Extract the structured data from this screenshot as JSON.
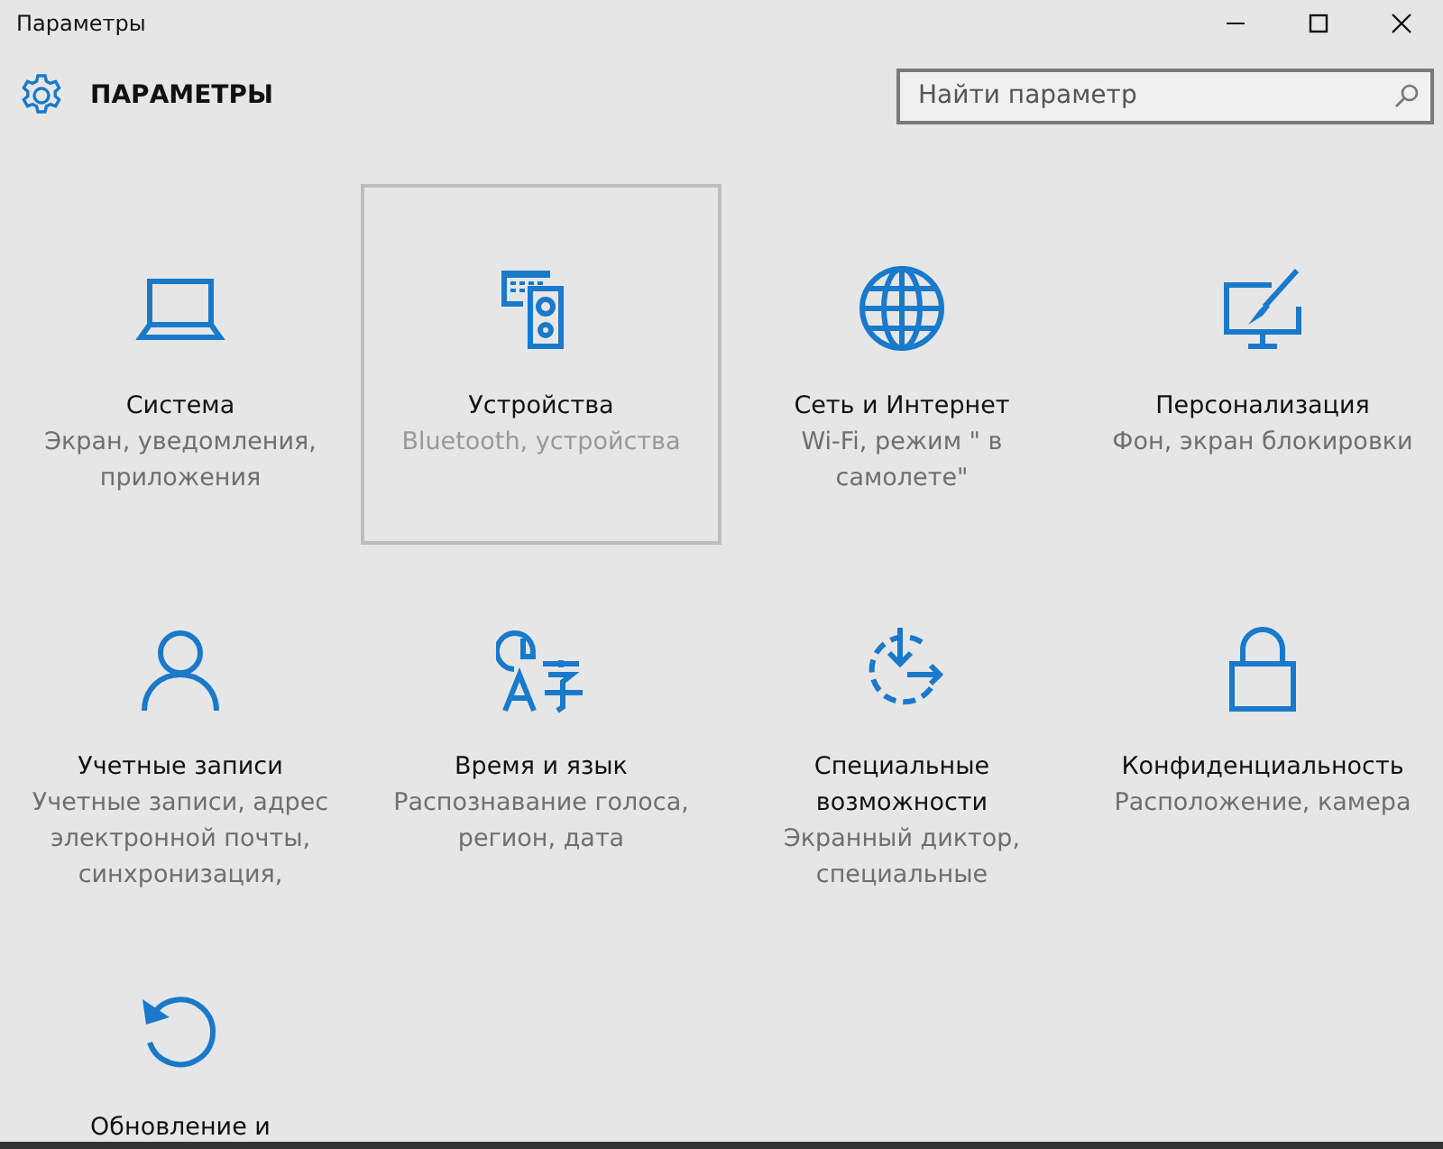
{
  "window": {
    "title": "Параметры"
  },
  "header": {
    "title": "ПАРАМЕТРЫ",
    "search": {
      "placeholder": "Найти параметр"
    }
  },
  "tiles": [
    {
      "title": "Система",
      "description": "Экран, уведомления, приложения",
      "selected": false
    },
    {
      "title": "Устройства",
      "description": "Bluetooth, устройства",
      "selected": true
    },
    {
      "title": "Сеть и Интернет",
      "description": "Wi-Fi, режим \" в самолете\"",
      "selected": false
    },
    {
      "title": "Персонализация",
      "description": "Фон, экран блокировки",
      "selected": false
    },
    {
      "title": "Учетные записи",
      "description": "Учетные записи, адрес электронной почты, синхронизация,",
      "selected": false
    },
    {
      "title": "Время и язык",
      "description": "Распознавание голоса, регион, дата",
      "selected": false
    },
    {
      "title": "Специальные возможности",
      "description": "Экранный диктор, специальные",
      "selected": false
    },
    {
      "title": "Конфиденциальность",
      "description": "Расположение, камера",
      "selected": false
    },
    {
      "title": "Обновление и",
      "selected": false
    }
  ]
}
